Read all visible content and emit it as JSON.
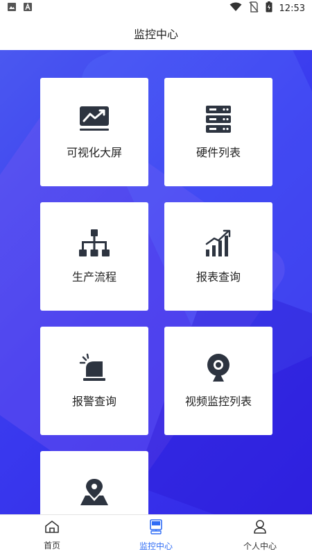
{
  "status_bar": {
    "time": "12:53",
    "left_icons": [
      "image-icon",
      "font-a-icon"
    ],
    "right_icons": [
      "wifi-icon",
      "no-sim-icon",
      "battery-charging-icon"
    ]
  },
  "header": {
    "title": "监控中心"
  },
  "grid": {
    "items": [
      {
        "label": "可视化大屏",
        "icon": "dashboard-trend-icon"
      },
      {
        "label": "硬件列表",
        "icon": "server-list-icon"
      },
      {
        "label": "生产流程",
        "icon": "hierarchy-icon"
      },
      {
        "label": "报表查询",
        "icon": "growth-chart-icon"
      },
      {
        "label": "报警查询",
        "icon": "alarm-beacon-icon"
      },
      {
        "label": "视频监控列表",
        "icon": "webcam-icon"
      },
      {
        "label": "",
        "icon": "map-pin-icon"
      }
    ]
  },
  "bottom_nav": {
    "items": [
      {
        "label": "首页",
        "icon": "home-icon",
        "active": false
      },
      {
        "label": "监控中心",
        "icon": "monitor-icon",
        "active": true
      },
      {
        "label": "个人中心",
        "icon": "user-icon",
        "active": false
      }
    ]
  },
  "colors": {
    "active": "#2f6cf5",
    "icon_dark": "#2d3440",
    "background_gradient": [
      "#4a58f0",
      "#3327e6"
    ]
  }
}
